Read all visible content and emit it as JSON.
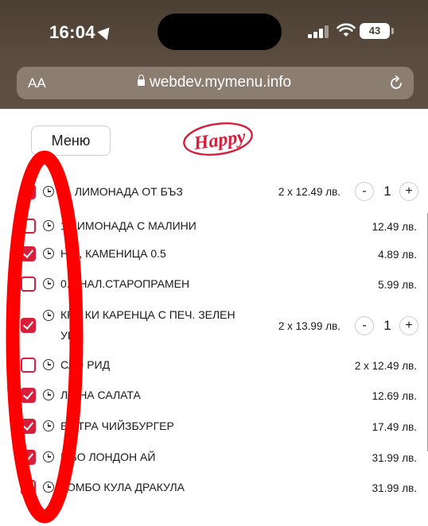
{
  "status_bar": {
    "time": "16:04",
    "battery": "43"
  },
  "browser": {
    "text_size": "AA",
    "url": "webdev.mymenu.info"
  },
  "header": {
    "menu_button": "Меню",
    "logo_text": "Happy"
  },
  "colors": {
    "accent": "#d51f3b",
    "annotation": "#ff0000"
  },
  "items": [
    {
      "checked": true,
      "name": "П. ЛИМОНАДА ОТ БЪЗ",
      "price": "2 x 12.49 лв.",
      "quantity": "1"
    },
    {
      "checked": false,
      "name": "1 ЛИМОНАДА С МАЛИНИ",
      "price": "12.49 лв."
    },
    {
      "checked": true,
      "name": "НА , КАМЕНИЦА 0.5",
      "price": "4.89 лв."
    },
    {
      "checked": false,
      "name": "0.5 НАЛ.СТАРОПРАМЕН",
      "price": "5.99 лв."
    },
    {
      "checked": true,
      "name": "КРЕ КИ КАРЕНЦА С ПЕЧ. ЗЕЛЕН УЦИ",
      "price": "2 x 13.99 лв.",
      "quantity": "1"
    },
    {
      "checked": false,
      "name": "САФ РИД",
      "price": "2 x 12.49 лв."
    },
    {
      "checked": true,
      "name": "ЛЯ НА САЛАТА",
      "price": "12.69 лв."
    },
    {
      "checked": true,
      "name": "ЕК ТРА ЧИЙЗБУРГЕР",
      "price": "17.49 лв."
    },
    {
      "checked": true,
      "name": "МБО ЛОНДОН АЙ",
      "price": "31.99 лв."
    },
    {
      "checked": false,
      "name": "КОМБО КУЛА ДРАКУЛА",
      "price": "31.99 лв."
    }
  ],
  "stepper": {
    "minus": "-",
    "plus": "+"
  }
}
